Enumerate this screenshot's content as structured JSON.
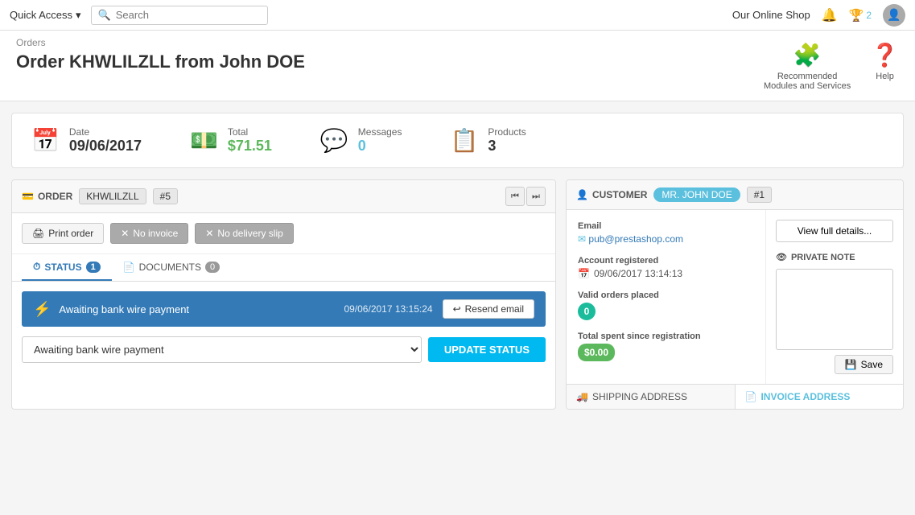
{
  "topnav": {
    "quick_access_label": "Quick Access",
    "search_placeholder": "Search",
    "shop_name": "Our Online Shop",
    "trophy_count": "2"
  },
  "page_header": {
    "breadcrumb": "Orders",
    "title": "Order KHWLILZLL from John DOE",
    "recommended_label": "Recommended Modules and Services",
    "help_label": "Help"
  },
  "stats": {
    "date_label": "Date",
    "date_value": "09/06/2017",
    "total_label": "Total",
    "total_value": "$71.51",
    "messages_label": "Messages",
    "messages_value": "0",
    "products_label": "Products",
    "products_value": "3"
  },
  "order_panel": {
    "order_label": "ORDER",
    "order_id": "KHWLILZLL",
    "order_num": "#5",
    "print_order_label": "Print order",
    "no_invoice_label": "No invoice",
    "no_delivery_label": "No delivery slip",
    "status_tab_label": "STATUS",
    "status_tab_count": "1",
    "documents_tab_label": "DOCUMENTS",
    "documents_tab_count": "0",
    "status_text": "Awaiting bank wire payment",
    "status_date": "09/06/2017 13:15:24",
    "resend_label": "Resend email",
    "select_status_value": "Awaiting bank wire payment",
    "update_btn_label": "UPDATE STATUS"
  },
  "customer_panel": {
    "customer_label": "CUSTOMER",
    "customer_name": "MR. JOHN DOE",
    "customer_num": "#1",
    "view_details_label": "View full details...",
    "email_label": "Email",
    "email_value": "pub@prestashop.com",
    "registered_label": "Account registered",
    "registered_value": "09/06/2017 13:14:13",
    "valid_orders_label": "Valid orders placed",
    "valid_orders_value": "0",
    "total_spent_label": "Total spent since registration",
    "total_spent_value": "$0.00",
    "private_note_label": "PRIVATE NOTE",
    "save_label": "Save",
    "shipping_tab_label": "SHIPPING ADDRESS",
    "invoice_tab_label": "INVOICE ADDRESS"
  }
}
